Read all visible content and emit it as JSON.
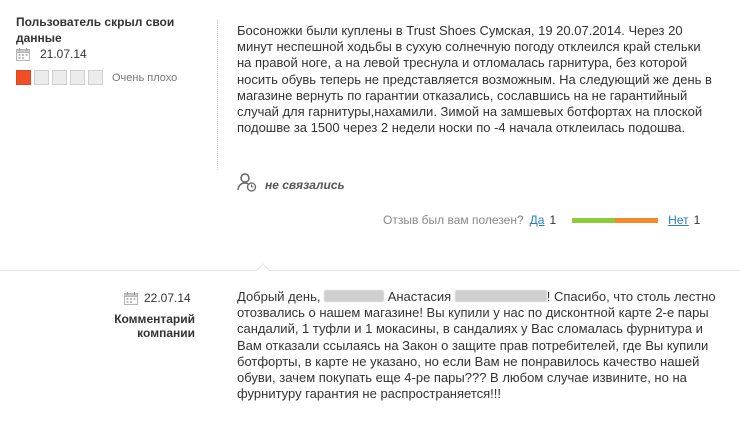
{
  "review": {
    "author": "Пользователь скрыл свои данные",
    "date": "21.07.14",
    "rating": {
      "value": 1,
      "max": 5,
      "label": "Очень плохо"
    },
    "text": "Босоножки были куплены в Trust Shoes Сумская, 19 20.07.2014. Через 20 минут неспешной ходьбы в сухую солнечную погоду отклеился край стельки на правой ноге, а на левой треснула и отломалась гарнитура, без которой носить обувь теперь не представляется возможным. На следующий же день в магазине вернуть по гарантии отказались, сославшись на не гарантийный случай для гарнитуры,нахамили. Зимой на замшевых ботфортах на плоской подошве за 1500 через 2 недели носки по -4 начала отклеилась подошва.",
    "status": "не связались",
    "helpful": {
      "question": "Отзыв был вам полезен?",
      "yes_label": "Да",
      "yes_count": "1",
      "no_label": "Нет",
      "no_count": "1",
      "yes_share": 0.5,
      "colors": {
        "yes": "#8ccc3c",
        "no": "#f48a2c"
      }
    }
  },
  "company_reply": {
    "date": "22.07.14",
    "label": "Комментарий компании",
    "greeting": "Добрый день,",
    "name": "Анастасия",
    "text_rest": "! Спасибо, что столь лестно отозвались о нашем магазине! Вы купили у нас по дисконтной карте 2-е пары сандалий, 1 туфли и 1 мокасины, в сандалиях у Вас сломалась фурнитура и Вам отказали ссылаясь на Закон о защите прав потребителей, где Вы купили ботфорты, в карте не указано, но если Вам не понравилось качество нашей обуви, зачем покупать еще 4-ре пары??? В любом случае извините, но на фурнитуру гарантия не распространяется!!!"
  },
  "icons": [
    "calendar-icon",
    "agent-clock-icon"
  ]
}
